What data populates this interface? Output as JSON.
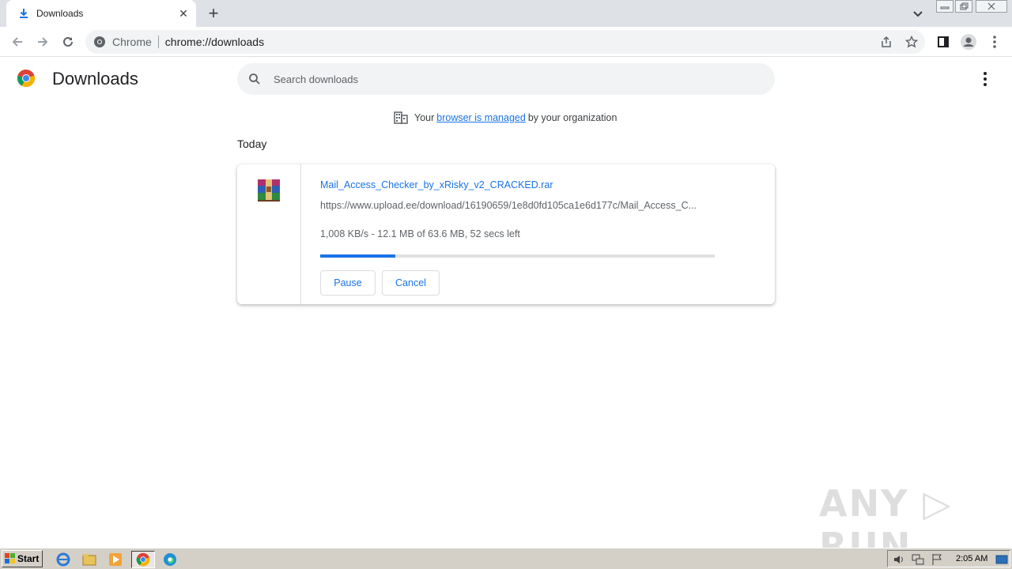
{
  "browser": {
    "tab": {
      "title": "Downloads",
      "icon": "download-icon"
    },
    "omnibox": {
      "site_label": "Chrome",
      "url": "chrome://downloads"
    }
  },
  "page": {
    "title": "Downloads",
    "search_placeholder": "Search downloads",
    "managed": {
      "prefix": "Your",
      "link": "browser is managed",
      "suffix": "by your organization"
    },
    "section_label": "Today"
  },
  "download": {
    "file_name": "Mail_Access_Checker_by_xRisky_v2_CRACKED.rar",
    "url": "https://www.upload.ee/download/16190659/1e8d0fd105ca1e6d177c/Mail_Access_C...",
    "status": "1,008 KB/s - 12.1 MB of 63.6 MB, 52 secs left",
    "progress": 0.19,
    "pause_label": "Pause",
    "cancel_label": "Cancel",
    "icon": "winrar-archive-icon"
  },
  "watermark": "ANY ▷ RUN",
  "taskbar": {
    "start_label": "Start",
    "clock": "2:05 AM"
  },
  "colors": {
    "accent": "#1a73e8",
    "tabstrip": "#dee1e6",
    "taskbar": "#d4d0c8"
  }
}
